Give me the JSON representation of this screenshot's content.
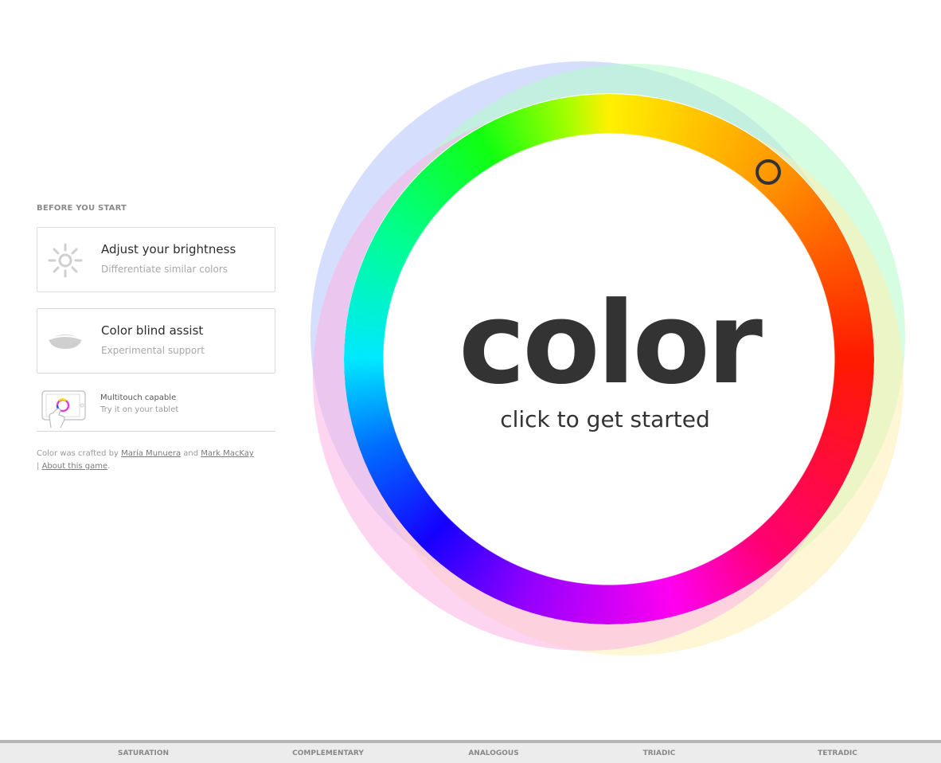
{
  "sidebar": {
    "section_title": "BEFORE YOU START",
    "cards": [
      {
        "title": "Adjust your brightness",
        "subtitle": "Differentiate similar colors",
        "icon": "sun-icon"
      },
      {
        "title": "Color blind assist",
        "subtitle": "Experimental support",
        "icon": "eye-icon"
      }
    ],
    "multitouch": {
      "title": "Multitouch capable",
      "subtitle": "Try it on your tablet",
      "icon": "tablet-touch-icon"
    },
    "credits": {
      "prefix": "Color was crafted by ",
      "author1": "María Munuera",
      "and": " and ",
      "author2": "Mark MacKay",
      "separator": " | ",
      "about": "About this game",
      "suffix": "."
    }
  },
  "hero": {
    "title": "color",
    "subtitle": "click to get started"
  },
  "wheel": {
    "overlay_colors": [
      "#b3c4fb",
      "#b3fbc8",
      "#c9f48d",
      "#fdeeb0",
      "#fdb3e6",
      "#fdb0b0",
      "#80d4c9",
      "#c28ae2"
    ],
    "knob_color": "#333333"
  },
  "bottom_nav": {
    "items": [
      "SATURATION",
      "COMPLEMENTARY",
      "ANALOGOUS",
      "TRIADIC",
      "TETRADIC"
    ]
  }
}
